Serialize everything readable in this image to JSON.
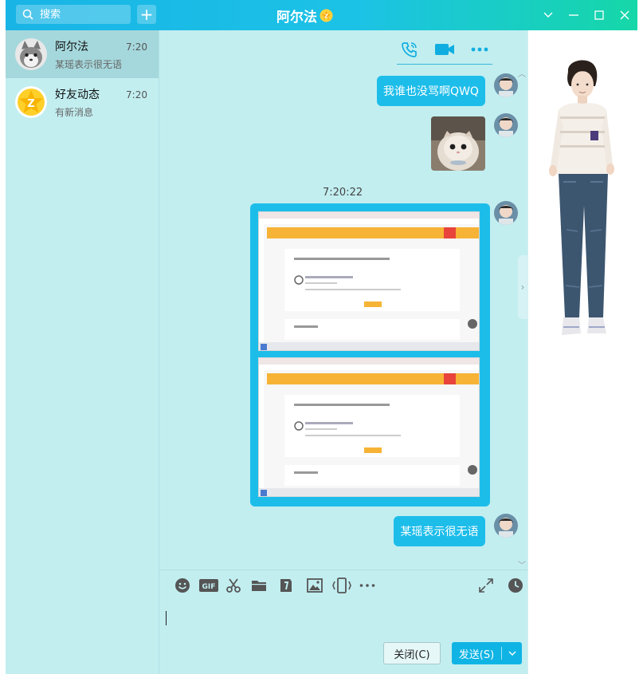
{
  "window": {
    "title": "阿尔法",
    "search_placeholder": "搜索",
    "plus_icon": "plus-icon",
    "vip_badge_icon": "vip-badge-icon"
  },
  "sidebar": {
    "items": [
      {
        "name": "阿尔法",
        "preview": "某瑶表示很无语",
        "time": "7:20",
        "icon": "wolf-avatar",
        "active": true
      },
      {
        "name": "好友动态",
        "preview": "有新消息",
        "time": "7:20",
        "icon": "star-avatar",
        "active": false
      }
    ]
  },
  "chat": {
    "toolbar_icons": [
      "phone-icon",
      "video-icon",
      "more-icon"
    ],
    "messages": [
      {
        "type": "text",
        "text": "我谁也没骂啊QWQ"
      },
      {
        "type": "image",
        "desc": "cat-photo"
      },
      {
        "type": "timestamp",
        "text": "7:20:22"
      },
      {
        "type": "image",
        "desc": "screenshots"
      },
      {
        "type": "text",
        "text": "某瑶表示很无语"
      }
    ],
    "input_toolbar_icons": [
      "emoji-icon",
      "gif-icon",
      "scissors-icon",
      "folder-icon",
      "file-transfer-icon",
      "image-icon",
      "phone-shake-icon",
      "more-icon",
      "expand-icon",
      "history-icon"
    ],
    "close_label": "关闭(C)",
    "send_label": "发送(S)"
  },
  "colors": {
    "accent": "#1dbdea",
    "bg": "#c2eef0",
    "title_gradient_start": "#18b4e6",
    "title_gradient_end": "#16d7a8"
  }
}
